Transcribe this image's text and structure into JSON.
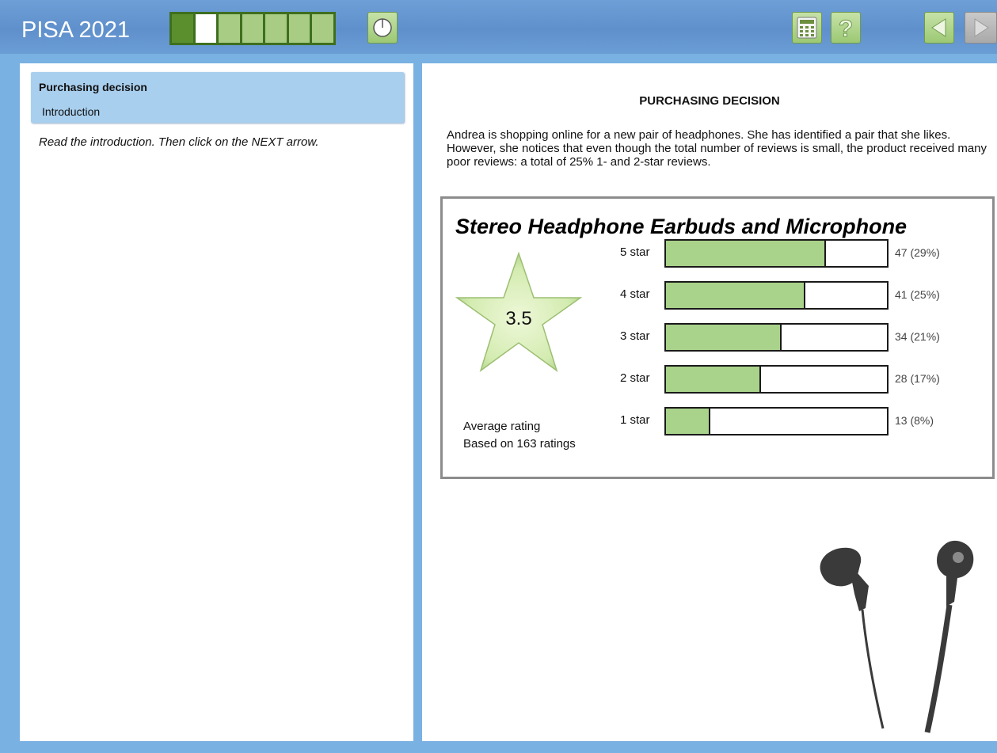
{
  "header": {
    "app_title": "PISA 2021",
    "progress": {
      "segments": 7,
      "done": 1,
      "current_index": 1
    },
    "icons": {
      "timer": "timer-icon",
      "calculator": "calculator-icon",
      "help": "help-icon",
      "back": "back-arrow-icon",
      "next": "next-arrow-icon"
    }
  },
  "sidebar": {
    "title": "Purchasing decision",
    "subtitle": "Introduction",
    "instruction": "Read the introduction. Then click on the NEXT arrow."
  },
  "stimulus": {
    "title": "PURCHASING DECISION",
    "text": "Andrea is shopping online for a new pair of headphones. She has identified a pair that she likes. However, she notices that even though the total number of reviews is small, the product received many poor reviews: a total of 25% 1- and 2-star reviews.",
    "product": {
      "name": "Stereo Headphone Earbuds and Microphone",
      "average_rating": "3.5",
      "average_label": "Average rating",
      "based_on": "Based on 163 ratings"
    }
  },
  "chart_data": {
    "type": "bar",
    "categories": [
      "5 star",
      "4 star",
      "3 star",
      "2 star",
      "1 star"
    ],
    "values": [
      47,
      41,
      34,
      28,
      13
    ],
    "value_labels": [
      "47 (29%)",
      "41 (25%)",
      "34 (21%)",
      "28 (17%)",
      "13 (8%)"
    ],
    "xlim": [
      0,
      65
    ],
    "colors": {
      "fill": "#a9d28a",
      "track": "#ffffff"
    }
  },
  "colors": {
    "background": "#79b1e3",
    "topbar": "#6e9fd6",
    "nav_highlight": "#a9cfee",
    "accent_green": "#a8cc84"
  }
}
